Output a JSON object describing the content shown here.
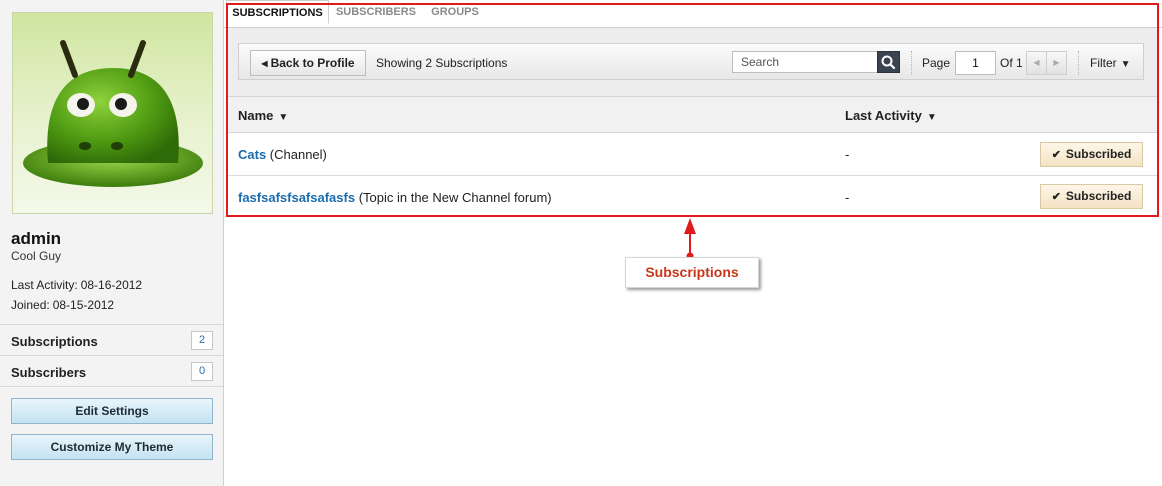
{
  "sidebar": {
    "user_name": "admin",
    "user_title": "Cool Guy",
    "last_activity_label": "Last Activity:",
    "last_activity_value": "08-16-2012",
    "joined_label": "Joined:",
    "joined_value": "08-15-2012",
    "counts": [
      {
        "label": "Subscriptions",
        "count": "2"
      },
      {
        "label": "Subscribers",
        "count": "0"
      }
    ],
    "buttons": {
      "edit_settings": "Edit Settings",
      "customize_theme": "Customize My Theme"
    }
  },
  "tabs": [
    {
      "label": "SUBSCRIPTIONS",
      "active": true
    },
    {
      "label": "SUBSCRIBERS",
      "active": false
    },
    {
      "label": "GROUPS",
      "active": false
    }
  ],
  "toolbar": {
    "back_label": "Back to Profile",
    "showing_text": "Showing 2 Subscriptions",
    "search_placeholder": "Search",
    "page_label": "Page",
    "page_value": "1",
    "of_label": "Of 1",
    "filter_label": "Filter"
  },
  "table": {
    "columns": [
      "Name",
      "Last Activity"
    ],
    "rows": [
      {
        "link": "Cats",
        "suffix": " (Channel)",
        "last_activity": "-",
        "status": "Subscribed"
      },
      {
        "link": "fasfsafsfsafsafasfs",
        "suffix": " (Topic in the New Channel forum)",
        "last_activity": "-",
        "status": "Subscribed"
      }
    ]
  },
  "annotation": {
    "label": "Subscriptions"
  },
  "colors": {
    "highlight": "#e01b1b",
    "link": "#1a6cb0",
    "annotation_text": "#c8361b",
    "side_button": "#c4e3f1"
  },
  "icons": [
    "search-icon",
    "back-arrow-icon",
    "chevron-left-icon",
    "chevron-right-icon",
    "caret-down-icon",
    "checkmark-icon",
    "avatar-image"
  ]
}
